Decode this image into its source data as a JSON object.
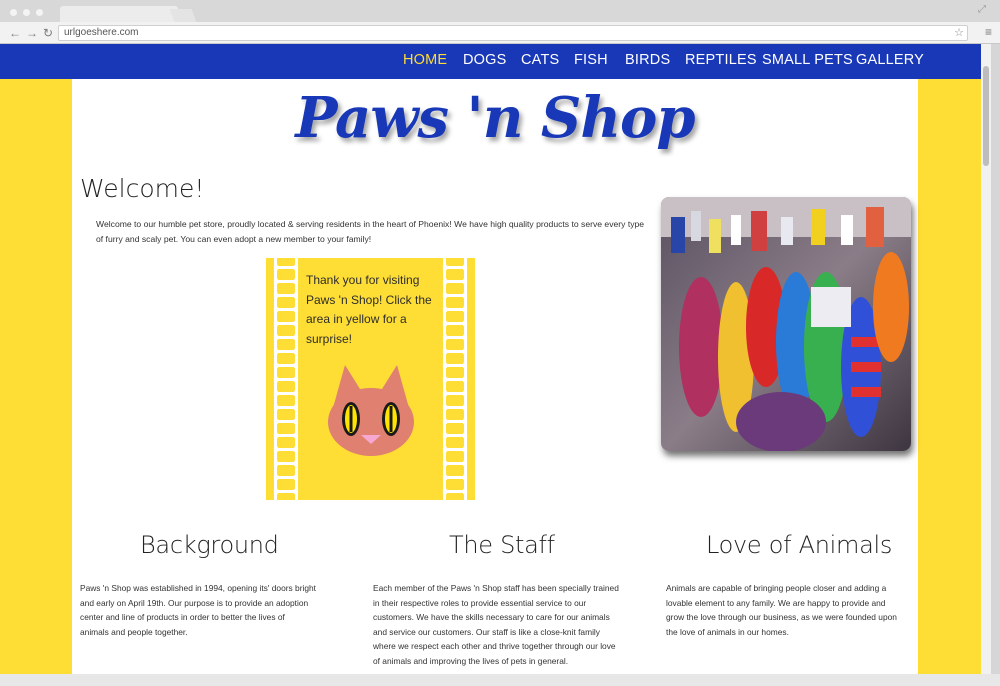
{
  "browser": {
    "url": "urlgoeshere.com",
    "back_icon": "back-arrow-icon",
    "forward_icon": "forward-arrow-icon",
    "reload_icon": "reload-icon",
    "bookmark_icon": "star-icon",
    "menu_icon": "hamburger-menu-icon"
  },
  "nav": {
    "items": [
      {
        "label": "HOME",
        "active": true
      },
      {
        "label": "DOGS",
        "active": false
      },
      {
        "label": "CATS",
        "active": false
      },
      {
        "label": "FISH",
        "active": false
      },
      {
        "label": "BIRDS",
        "active": false
      },
      {
        "label": "REPTILES",
        "active": false
      },
      {
        "label": "SMALL PETS",
        "active": false
      },
      {
        "label": "GALLERY",
        "active": false
      }
    ]
  },
  "site": {
    "logo": "Paws 'n Shop"
  },
  "welcome": {
    "heading": "Welcome!",
    "text": "Welcome to our humble pet store, proudly located & serving residents in the heart of Phoenix! We have high quality products to serve every type of furry and scaly pet. You can even adopt a new member to your family!"
  },
  "promo": {
    "text": "Thank you for visiting Paws 'n Shop! Click the area in yellow for a surprise!"
  },
  "columns": [
    {
      "heading": "Background",
      "text": "Paws 'n Shop was established in 1994, opening its' doors bright and early on April 19th. Our purpose is to provide an adoption center and line of products in order to better the lives of animals and people together."
    },
    {
      "heading": "The Staff",
      "text": "Each member of the Paws 'n Shop staff has been specially trained in their respective roles to provide essential service to our customers. We have the skills necessary to care for our animals and service our customers. Our staff is like a close-knit family where we respect each other and thrive together through our love of animals and improving the lives of pets in general."
    },
    {
      "heading": "Love of Animals",
      "text": "Animals are capable of bringing people closer and adding a lovable element to any family. We are happy to provide and grow the love through our business, as we were founded upon the love of animals in our homes."
    }
  ],
  "colors": {
    "brand_blue": "#1838b8",
    "brand_yellow": "#fedd35",
    "active_nav": "#fedd35",
    "cat_face": "#e08070",
    "cat_eye": "#ffe400"
  }
}
